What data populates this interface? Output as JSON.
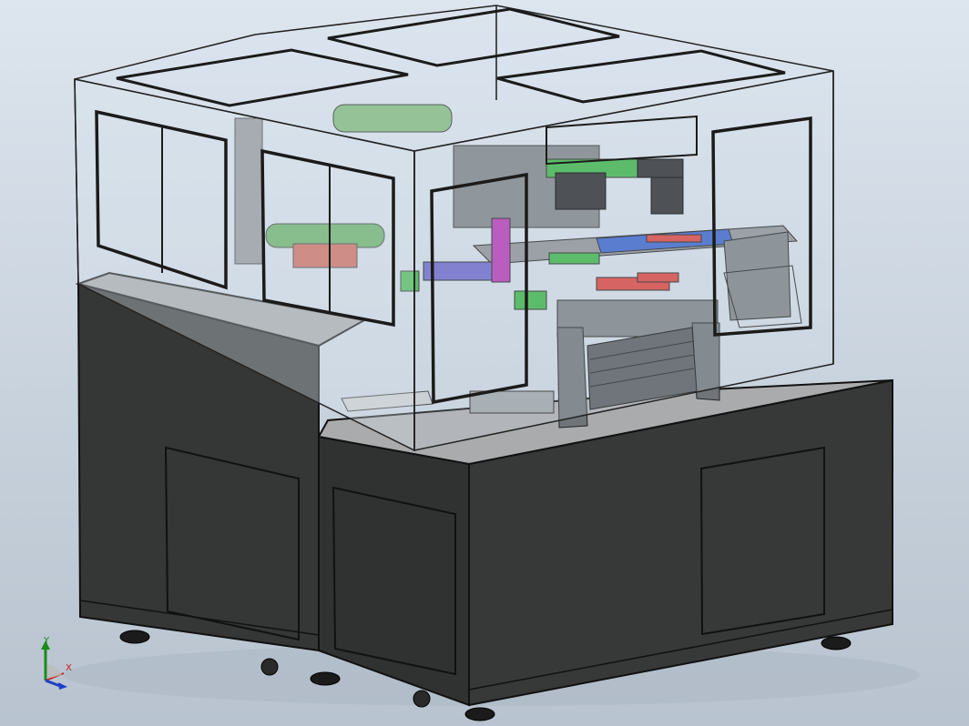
{
  "viewport": {
    "background_top": "#dde5ee",
    "background_bottom": "#b8c3cf"
  },
  "model": {
    "description": "cad-assembly-automation-machine",
    "colors": {
      "cabinet": "#353836",
      "cabinet_edge": "#121212",
      "deck": "#a7a9ab",
      "enclosure_glass": "#d9e4ee",
      "frame": "#6f7478",
      "accent_green": "#3fb24a",
      "accent_red": "#d6443f",
      "accent_blue": "#3b63c7",
      "accent_magenta": "#b23bb3"
    }
  },
  "triad": {
    "x_label": "X",
    "y_label": "Y",
    "x_color": "#c81e1e",
    "y_color": "#1a8a1a",
    "z_color": "#1e3fc8"
  }
}
